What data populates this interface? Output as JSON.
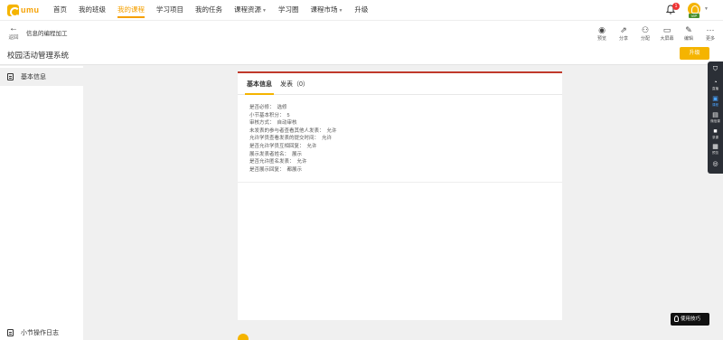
{
  "brand": {
    "logo_text": "umu"
  },
  "nav": {
    "items": [
      {
        "label": "首页",
        "active": false,
        "dropdown": false
      },
      {
        "label": "我的班级",
        "active": false,
        "dropdown": false
      },
      {
        "label": "我的课程",
        "active": true,
        "dropdown": false
      },
      {
        "label": "学习项目",
        "active": false,
        "dropdown": false
      },
      {
        "label": "我的任务",
        "active": false,
        "dropdown": false
      },
      {
        "label": "课程资源",
        "active": false,
        "dropdown": true
      },
      {
        "label": "学习圈",
        "active": false,
        "dropdown": false
      },
      {
        "label": "课程市场",
        "active": false,
        "dropdown": true
      },
      {
        "label": "升级",
        "active": false,
        "dropdown": false
      }
    ],
    "notification_count": "1",
    "user_badge": "VIP"
  },
  "subbar": {
    "back_label": "返回",
    "breadcrumb": "信息的编程加工",
    "page_title": "校园活动管理系统",
    "tools": [
      {
        "label": "预览",
        "icon": "eye-icon",
        "glyph": "◉"
      },
      {
        "label": "分享",
        "icon": "share-icon",
        "glyph": "⇗"
      },
      {
        "label": "分配",
        "icon": "assign-user-icon",
        "glyph": "⚇"
      },
      {
        "label": "大屏幕",
        "icon": "monitor-icon",
        "glyph": "▭"
      },
      {
        "label": "编辑",
        "icon": "edit-icon",
        "glyph": "✎"
      },
      {
        "label": "更多",
        "icon": "more-icon",
        "glyph": "···"
      }
    ],
    "upgrade_label": "升级"
  },
  "sidebar": {
    "items": [
      {
        "label": "基本信息",
        "active": true
      },
      {
        "label": "小节操作日志",
        "active": false
      }
    ]
  },
  "card": {
    "tabs": [
      {
        "label": "基本信息",
        "active": true
      },
      {
        "label": "发表（0）",
        "active": false
      }
    ],
    "info": [
      {
        "key": "是否必修：",
        "value": "选修"
      },
      {
        "key": "小节基本积分：",
        "value": "5"
      },
      {
        "key": "审核方式：",
        "value": "自动审核"
      },
      {
        "key": "未发表的参与者查看其他人发表：",
        "value": "允许"
      },
      {
        "key": "允许学员查看发表的提交时间：",
        "value": "允许"
      },
      {
        "key": "是否允许学员互相回复：",
        "value": "允许"
      },
      {
        "key": "展示发表者姓名：",
        "value": "展示"
      },
      {
        "key": "是否允许匿名发表：",
        "value": "允许"
      },
      {
        "key": "是否展示回复：",
        "value": "都展示"
      }
    ]
  },
  "rightbar": {
    "items": [
      {
        "label": "",
        "icon": "shield-icon",
        "glyph": "⛉",
        "active": false
      },
      {
        "label": "直播",
        "icon": "live-icon",
        "glyph": "◔",
        "active": false
      },
      {
        "label": "课程",
        "icon": "course-icon",
        "glyph": "▣",
        "active": true
      },
      {
        "label": "微信课",
        "icon": "wechat-course-icon",
        "glyph": "▤",
        "active": false
      },
      {
        "label": "录课",
        "icon": "record-icon",
        "glyph": "■",
        "active": false
      },
      {
        "label": "预览",
        "icon": "preview-icon",
        "glyph": "▦",
        "active": false
      },
      {
        "label": "",
        "icon": "settings-icon",
        "glyph": "◎",
        "active": false
      }
    ]
  },
  "tips_label": "使用技巧"
}
